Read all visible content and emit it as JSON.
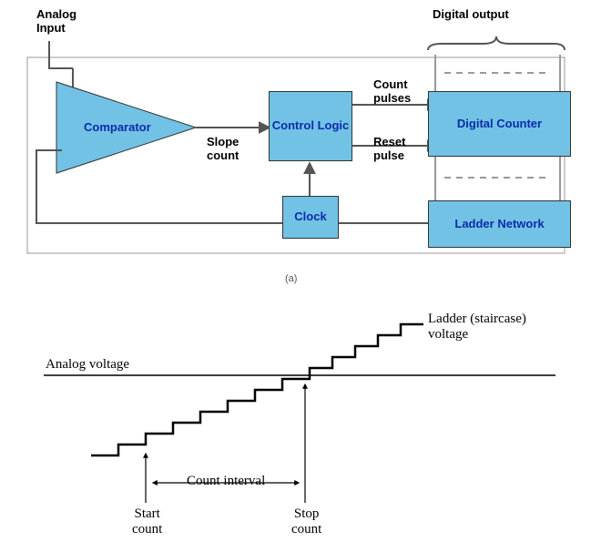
{
  "diagram": {
    "title_analog_input": "Analog\nInput",
    "title_digital_output": "Digital output",
    "block_comparator": "Comparator",
    "block_control_logic": "Control\nLogic",
    "block_clock": "Clock",
    "block_digital_counter": "Digital Counter",
    "block_ladder_network": "Ladder Network",
    "signal_slope_count": "Slope\ncount",
    "signal_count_pulses": "Count\npulses",
    "signal_reset_pulse": "Reset\npulse",
    "sublabel_a": "(a)"
  },
  "waveform": {
    "label_ladder": "Ladder (staircase)\nvoltage",
    "label_analog_voltage": "Analog voltage",
    "label_count_interval": "Count interval",
    "label_start_count": "Start\ncount",
    "label_stop_count": "Stop\ncount"
  }
}
